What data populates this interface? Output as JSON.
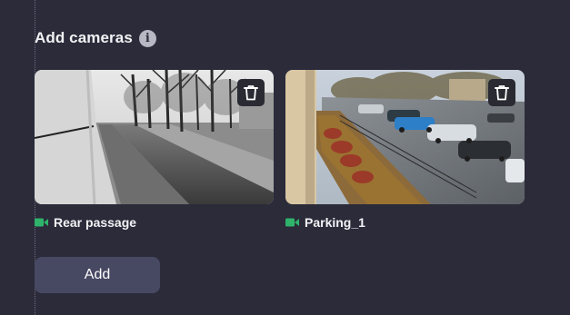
{
  "section": {
    "title": "Add cameras",
    "info_icon": "info-icon"
  },
  "cameras": [
    {
      "name": "Rear passage",
      "status_color": "#2fb36b",
      "status_icon": "video-camera-icon",
      "delete_icon": "trash-icon",
      "preview": "grayscale street view with trees and walkway"
    },
    {
      "name": "Parking_1",
      "status_color": "#2fb36b",
      "status_icon": "video-camera-icon",
      "delete_icon": "trash-icon",
      "preview": "color parking lot view with cars"
    }
  ],
  "actions": {
    "add_label": "Add"
  },
  "colors": {
    "background": "#2b2b3a",
    "button": "#474862",
    "status_active": "#2fb36b"
  }
}
